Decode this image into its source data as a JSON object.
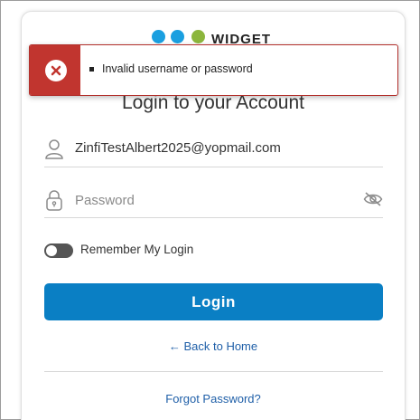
{
  "brand": {
    "logo_text": "WIDGET",
    "dot_colors": [
      "#1a9fe0",
      "#1a9fe0",
      "#8cb63c"
    ]
  },
  "alert": {
    "type": "error",
    "icon": "close-icon",
    "color": "#c1352f",
    "messages": [
      "Invalid username or password"
    ]
  },
  "form": {
    "title": "Login to your Account",
    "username": {
      "value": "ZinfiTestAlbert2025@yopmail.com",
      "icon": "user-icon"
    },
    "password": {
      "value": "",
      "placeholder": "Password",
      "icon": "lock-icon",
      "toggle_icon": "eye-off-icon"
    },
    "remember": {
      "label": "Remember My Login",
      "checked": false
    },
    "submit_label": "Login",
    "submit_color": "#0a7fc4",
    "back_link": "← Back to Home",
    "forgot_link": "Forgot Password?"
  }
}
